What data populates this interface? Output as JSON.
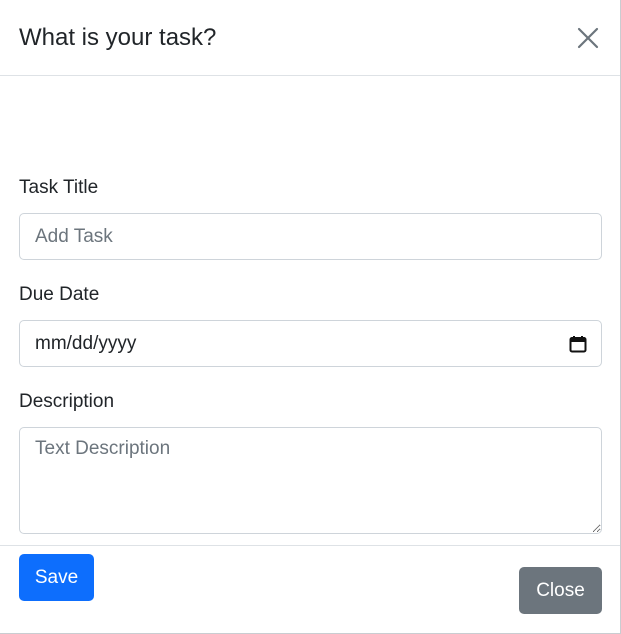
{
  "modal": {
    "title": "What is your task?"
  },
  "form": {
    "task_title": {
      "label": "Task Title",
      "placeholder": "Add Task",
      "value": ""
    },
    "due_date": {
      "label": "Due Date",
      "value": "mm/dd/yyyy"
    },
    "description": {
      "label": "Description",
      "placeholder": "Text Description",
      "value": ""
    }
  },
  "buttons": {
    "save": "Save",
    "close": "Close"
  },
  "icons": {
    "dismiss": "close-icon",
    "calendar": "calendar-icon"
  },
  "colors": {
    "primary": "#0d6efd",
    "secondary": "#6c757d",
    "text": "#212529",
    "placeholder": "#6c757d",
    "border": "#ced4da",
    "divider": "#dee2e6"
  }
}
